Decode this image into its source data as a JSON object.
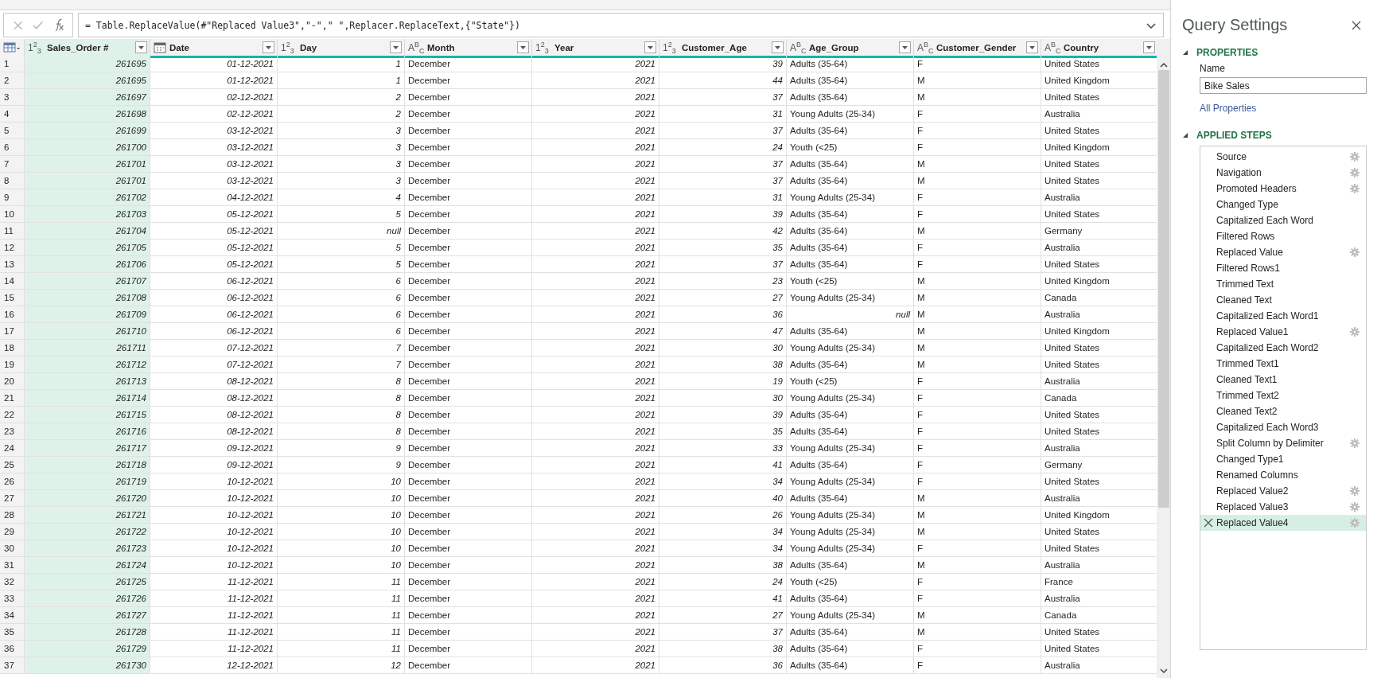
{
  "formula_bar": {
    "formula": "= Table.ReplaceValue(#\"Replaced Value3\",\"-\",\" \",Replacer.ReplaceText,{\"State\"})"
  },
  "table": {
    "columns": [
      {
        "label": "Sales_Order #",
        "kind": "number",
        "type_glyph": "1$^{2}$$_{3}$",
        "selected": true
      },
      {
        "label": "Date",
        "kind": "date",
        "selected": false
      },
      {
        "label": "Day",
        "kind": "number",
        "type_glyph": "1$^{2}$$_{3}$",
        "selected": false
      },
      {
        "label": "Month",
        "kind": "text",
        "type_glyph": "A$^{B}$$_{C}$",
        "selected": false
      },
      {
        "label": "Year",
        "kind": "number",
        "type_glyph": "1$^{2}$$_{3}$",
        "selected": false
      },
      {
        "label": "Customer_Age",
        "kind": "number",
        "type_glyph": "1$^{2}$$_{3}$",
        "selected": false
      },
      {
        "label": "Age_Group",
        "kind": "text",
        "type_glyph": "A$^{B}$$_{C}$",
        "selected": false
      },
      {
        "label": "Customer_Gender",
        "kind": "text",
        "type_glyph": "A$^{B}$$_{C}$",
        "selected": false
      },
      {
        "label": "Country",
        "kind": "text",
        "type_glyph": "A$^{B}$$_{C}$",
        "selected": false
      }
    ],
    "rows": [
      {
        "n": "1",
        "cells": [
          "261695",
          "01-12-2021",
          "1",
          "December",
          "2021",
          "39",
          "Adults (35-64)",
          "F",
          "United States"
        ]
      },
      {
        "n": "2",
        "cells": [
          "261695",
          "01-12-2021",
          "1",
          "December",
          "2021",
          "44",
          "Adults (35-64)",
          "M",
          "United Kingdom"
        ]
      },
      {
        "n": "3",
        "cells": [
          "261697",
          "02-12-2021",
          "2",
          "December",
          "2021",
          "37",
          "Adults (35-64)",
          "M",
          "United States"
        ]
      },
      {
        "n": "4",
        "cells": [
          "261698",
          "02-12-2021",
          "2",
          "December",
          "2021",
          "31",
          "Young Adults (25-34)",
          "F",
          "Australia"
        ]
      },
      {
        "n": "5",
        "cells": [
          "261699",
          "03-12-2021",
          "3",
          "December",
          "2021",
          "37",
          "Adults (35-64)",
          "F",
          "United States"
        ]
      },
      {
        "n": "6",
        "cells": [
          "261700",
          "03-12-2021",
          "3",
          "December",
          "2021",
          "24",
          "Youth (<25)",
          "F",
          "United Kingdom"
        ]
      },
      {
        "n": "7",
        "cells": [
          "261701",
          "03-12-2021",
          "3",
          "December",
          "2021",
          "37",
          "Adults (35-64)",
          "M",
          "United States"
        ]
      },
      {
        "n": "8",
        "cells": [
          "261701",
          "03-12-2021",
          "3",
          "December",
          "2021",
          "37",
          "Adults (35-64)",
          "M",
          "United States"
        ]
      },
      {
        "n": "9",
        "cells": [
          "261702",
          "04-12-2021",
          "4",
          "December",
          "2021",
          "31",
          "Young Adults (25-34)",
          "F",
          "Australia"
        ]
      },
      {
        "n": "10",
        "cells": [
          "261703",
          "05-12-2021",
          "5",
          "December",
          "2021",
          "39",
          "Adults (35-64)",
          "F",
          "United States"
        ]
      },
      {
        "n": "11",
        "cells": [
          "261704",
          "05-12-2021",
          {
            "kind": "null",
            "text": "null"
          },
          "December",
          "2021",
          "42",
          "Adults (35-64)",
          "M",
          "Germany"
        ]
      },
      {
        "n": "12",
        "cells": [
          "261705",
          "05-12-2021",
          "5",
          "December",
          "2021",
          "35",
          "Adults (35-64)",
          "F",
          "Australia"
        ]
      },
      {
        "n": "13",
        "cells": [
          "261706",
          "05-12-2021",
          "5",
          "December",
          "2021",
          "37",
          "Adults (35-64)",
          "F",
          "United States"
        ]
      },
      {
        "n": "14",
        "cells": [
          "261707",
          "06-12-2021",
          "6",
          "December",
          "2021",
          "23",
          "Youth (<25)",
          "M",
          "United Kingdom"
        ]
      },
      {
        "n": "15",
        "cells": [
          "261708",
          "06-12-2021",
          "6",
          "December",
          "2021",
          "27",
          "Young Adults (25-34)",
          "M",
          "Canada"
        ]
      },
      {
        "n": "16",
        "cells": [
          "261709",
          "06-12-2021",
          "6",
          "December",
          "2021",
          "36",
          {
            "kind": "null",
            "text": "null"
          },
          "M",
          "Australia"
        ]
      },
      {
        "n": "17",
        "cells": [
          "261710",
          "06-12-2021",
          "6",
          "December",
          "2021",
          "47",
          "Adults (35-64)",
          "M",
          "United Kingdom"
        ]
      },
      {
        "n": "18",
        "cells": [
          "261711",
          "07-12-2021",
          "7",
          "December",
          "2021",
          "30",
          "Young Adults (25-34)",
          "M",
          "United States"
        ]
      },
      {
        "n": "19",
        "cells": [
          "261712",
          "07-12-2021",
          "7",
          "December",
          "2021",
          "38",
          "Adults (35-64)",
          "M",
          "United States"
        ]
      },
      {
        "n": "20",
        "cells": [
          "261713",
          "08-12-2021",
          "8",
          "December",
          "2021",
          "19",
          "Youth (<25)",
          "F",
          "Australia"
        ]
      },
      {
        "n": "21",
        "cells": [
          "261714",
          "08-12-2021",
          "8",
          "December",
          "2021",
          "30",
          "Young Adults (25-34)",
          "F",
          "Canada"
        ]
      },
      {
        "n": "22",
        "cells": [
          "261715",
          "08-12-2021",
          "8",
          "December",
          "2021",
          "39",
          "Adults (35-64)",
          "F",
          "United States"
        ]
      },
      {
        "n": "23",
        "cells": [
          "261716",
          "08-12-2021",
          "8",
          "December",
          "2021",
          "35",
          "Adults (35-64)",
          "F",
          "United States"
        ]
      },
      {
        "n": "24",
        "cells": [
          "261717",
          "09-12-2021",
          "9",
          "December",
          "2021",
          "33",
          "Young Adults (25-34)",
          "F",
          "Australia"
        ]
      },
      {
        "n": "25",
        "cells": [
          "261718",
          "09-12-2021",
          "9",
          "December",
          "2021",
          "41",
          "Adults (35-64)",
          "F",
          "Germany"
        ]
      },
      {
        "n": "26",
        "cells": [
          "261719",
          "10-12-2021",
          "10",
          "December",
          "2021",
          "34",
          "Young Adults (25-34)",
          "F",
          "United States"
        ]
      },
      {
        "n": "27",
        "cells": [
          "261720",
          "10-12-2021",
          "10",
          "December",
          "2021",
          "40",
          "Adults (35-64)",
          "M",
          "Australia"
        ]
      },
      {
        "n": "28",
        "cells": [
          "261721",
          "10-12-2021",
          "10",
          "December",
          "2021",
          "26",
          "Young Adults (25-34)",
          "M",
          "United Kingdom"
        ]
      },
      {
        "n": "29",
        "cells": [
          "261722",
          "10-12-2021",
          "10",
          "December",
          "2021",
          "34",
          "Young Adults (25-34)",
          "M",
          "United States"
        ]
      },
      {
        "n": "30",
        "cells": [
          "261723",
          "10-12-2021",
          "10",
          "December",
          "2021",
          "34",
          "Young Adults (25-34)",
          "F",
          "United States"
        ]
      },
      {
        "n": "31",
        "cells": [
          "261724",
          "10-12-2021",
          "10",
          "December",
          "2021",
          "38",
          "Adults (35-64)",
          "M",
          "Australia"
        ]
      },
      {
        "n": "32",
        "cells": [
          "261725",
          "11-12-2021",
          "11",
          "December",
          "2021",
          "24",
          "Youth (<25)",
          "F",
          "France"
        ]
      },
      {
        "n": "33",
        "cells": [
          "261726",
          "11-12-2021",
          "11",
          "December",
          "2021",
          "41",
          "Adults (35-64)",
          "F",
          "Australia"
        ]
      },
      {
        "n": "34",
        "cells": [
          "261727",
          "11-12-2021",
          "11",
          "December",
          "2021",
          "27",
          "Young Adults (25-34)",
          "M",
          "Canada"
        ]
      },
      {
        "n": "35",
        "cells": [
          "261728",
          "11-12-2021",
          "11",
          "December",
          "2021",
          "37",
          "Adults (35-64)",
          "M",
          "United States"
        ]
      },
      {
        "n": "36",
        "cells": [
          "261729",
          "11-12-2021",
          "11",
          "December",
          "2021",
          "38",
          "Adults (35-64)",
          "F",
          "United States"
        ]
      },
      {
        "n": "37",
        "cells": [
          "261730",
          "12-12-2021",
          "12",
          "December",
          "2021",
          "36",
          "Adults (35-64)",
          "F",
          "Australia"
        ]
      }
    ]
  },
  "query_settings": {
    "title": "Query Settings",
    "properties": {
      "heading": "PROPERTIES",
      "expanded": true,
      "name_label": "Name",
      "name_value": "Bike Sales",
      "link": "All Properties"
    },
    "applied_steps": {
      "heading": "APPLIED STEPS",
      "expanded": true,
      "steps": [
        {
          "name": "Source",
          "gear": true,
          "selected": false
        },
        {
          "name": "Navigation",
          "gear": true,
          "selected": false
        },
        {
          "name": "Promoted Headers",
          "gear": true,
          "selected": false
        },
        {
          "name": "Changed Type",
          "gear": false,
          "selected": false
        },
        {
          "name": "Capitalized Each Word",
          "gear": false,
          "selected": false
        },
        {
          "name": "Filtered Rows",
          "gear": false,
          "selected": false
        },
        {
          "name": "Replaced Value",
          "gear": true,
          "selected": false
        },
        {
          "name": "Filtered Rows1",
          "gear": false,
          "selected": false
        },
        {
          "name": "Trimmed Text",
          "gear": false,
          "selected": false
        },
        {
          "name": "Cleaned Text",
          "gear": false,
          "selected": false
        },
        {
          "name": "Capitalized Each Word1",
          "gear": false,
          "selected": false
        },
        {
          "name": "Replaced Value1",
          "gear": true,
          "selected": false
        },
        {
          "name": "Capitalized Each Word2",
          "gear": false,
          "selected": false
        },
        {
          "name": "Trimmed Text1",
          "gear": false,
          "selected": false
        },
        {
          "name": "Cleaned Text1",
          "gear": false,
          "selected": false
        },
        {
          "name": "Trimmed Text2",
          "gear": false,
          "selected": false
        },
        {
          "name": "Cleaned Text2",
          "gear": false,
          "selected": false
        },
        {
          "name": "Capitalized Each Word3",
          "gear": false,
          "selected": false
        },
        {
          "name": "Split Column by Delimiter",
          "gear": true,
          "selected": false
        },
        {
          "name": "Changed Type1",
          "gear": false,
          "selected": false
        },
        {
          "name": "Renamed Columns",
          "gear": false,
          "selected": false
        },
        {
          "name": "Replaced Value2",
          "gear": true,
          "selected": false
        },
        {
          "name": "Replaced Value3",
          "gear": true,
          "selected": false
        },
        {
          "name": "Replaced Value4",
          "gear": true,
          "selected": true
        }
      ]
    }
  }
}
